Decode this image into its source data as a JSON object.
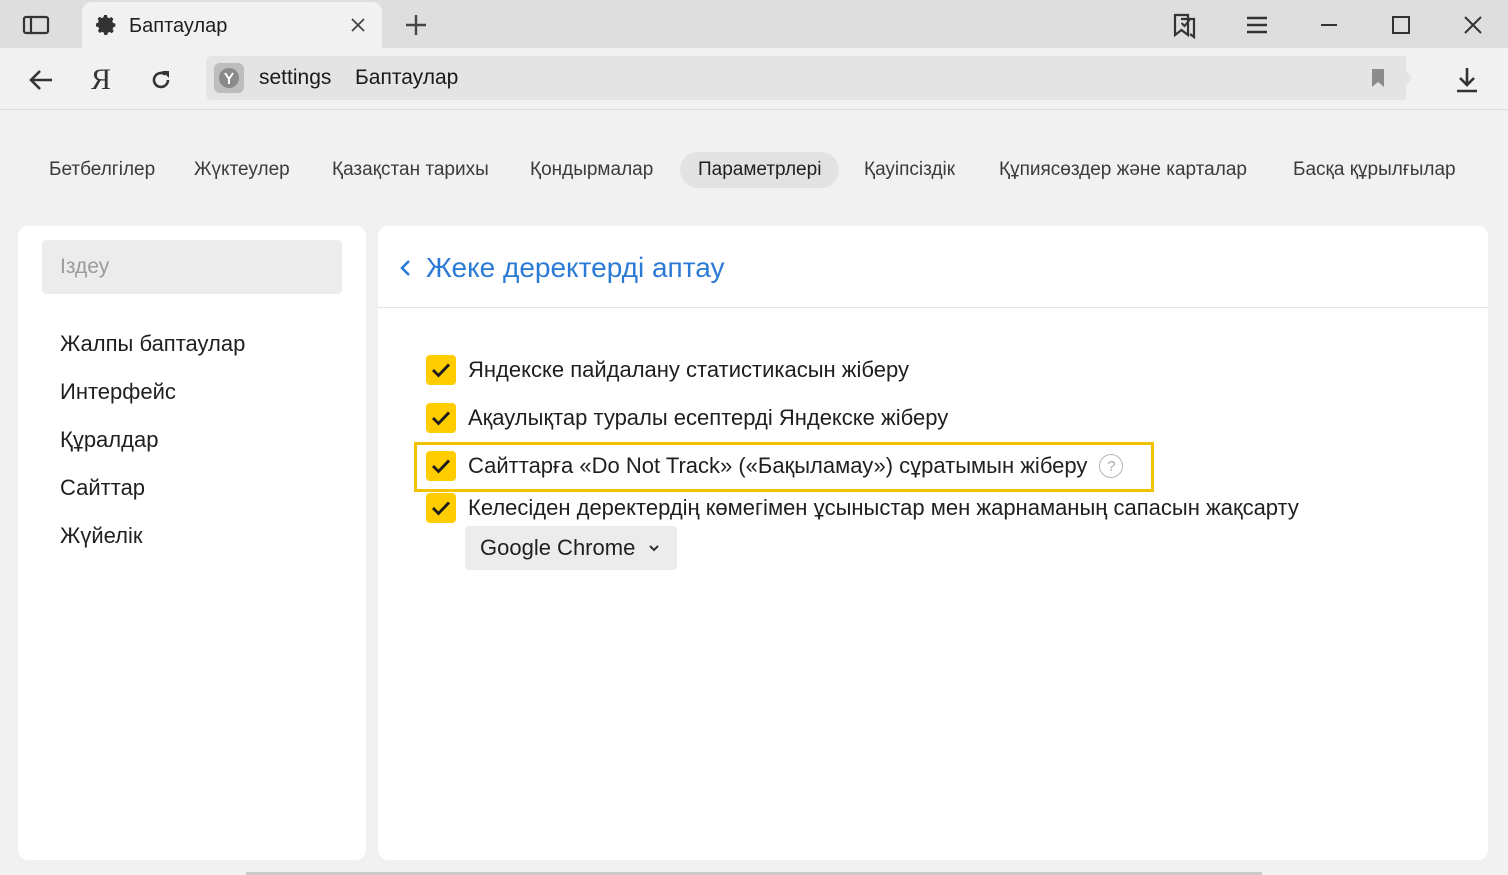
{
  "window": {
    "tab_title": "Баптаулар",
    "icons": [
      "sidebar-panel-icon",
      "gear-icon",
      "close-icon",
      "new-tab-plus-icon",
      "bookmarks-panel-icon",
      "menu-hamburger-icon",
      "minimize-icon",
      "maximize-icon",
      "window-close-icon"
    ]
  },
  "toolbar": {
    "yandex_button": "Я",
    "address_host": "settings",
    "address_title": "Баптаулар",
    "icons": [
      "back-arrow-icon",
      "reload-icon",
      "site-badge-icon",
      "bookmark-flag-icon",
      "download-icon"
    ]
  },
  "categories": [
    "Бетбелгілер",
    "Жүктеулер",
    "Қазақстан тарихы",
    "Қондырмалар",
    "Параметрлері",
    "Қауіпсіздік",
    "Құпиясөздер және карталар",
    "Басқа құрылғылар"
  ],
  "active_category": "Параметрлері",
  "sidebar": {
    "search_placeholder": "Іздеу",
    "items": [
      "Жалпы баптаулар",
      "Интерфейс",
      "Құралдар",
      "Сайттар",
      "Жүйелік"
    ]
  },
  "main": {
    "title": "Жеке деректерді аптау",
    "options": [
      {
        "label": "Яндекске пайдалану статистикасын жіберу",
        "checked": true
      },
      {
        "label": "Ақаулықтар туралы есептерді Яндекске жіберу",
        "checked": true
      },
      {
        "label": "Сайттарға «Do Not Track» («Бақыламау») сұратымын жіберу",
        "checked": true,
        "highlighted": true,
        "help": "?"
      },
      {
        "label": "Келесіден деректердің көмегімен ұсыныстар мен жарнаманың сапасын жақсарту",
        "checked": true
      }
    ],
    "dropdown_value": "Google Chrome"
  },
  "colors": {
    "checkbox": "#ffcc00",
    "highlight_border": "#f2c200",
    "title_link": "#2b7bd6",
    "background": "#f1f1f1",
    "titlebar": "#dedede"
  }
}
